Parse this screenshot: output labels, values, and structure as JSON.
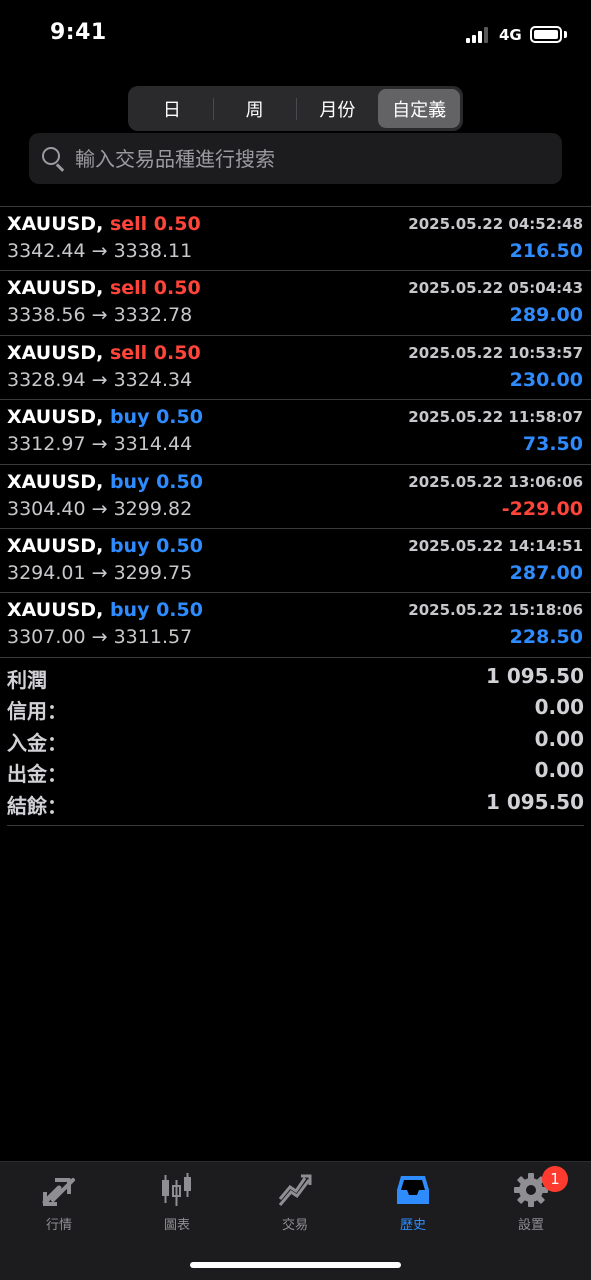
{
  "status_bar": {
    "time": "9:41",
    "network": "4G"
  },
  "period_tabs": [
    {
      "label": "日",
      "active": false
    },
    {
      "label": "周",
      "active": false
    },
    {
      "label": "月份",
      "active": false
    },
    {
      "label": "自定義",
      "active": true
    }
  ],
  "search": {
    "placeholder": "輸入交易品種進行搜索",
    "value": ""
  },
  "trades": [
    {
      "symbol": "XAUUSD,",
      "side": "sell",
      "volume": "0.50",
      "time": "2025.05.22 04:52:48",
      "open_price": "3342.44",
      "close_price": "3338.11",
      "arrow": "→",
      "profit": "216.50"
    },
    {
      "symbol": "XAUUSD,",
      "side": "sell",
      "volume": "0.50",
      "time": "2025.05.22 05:04:43",
      "open_price": "3338.56",
      "close_price": "3332.78",
      "arrow": "→",
      "profit": "289.00"
    },
    {
      "symbol": "XAUUSD,",
      "side": "sell",
      "volume": "0.50",
      "time": "2025.05.22 10:53:57",
      "open_price": "3328.94",
      "close_price": "3324.34",
      "arrow": "→",
      "profit": "230.00"
    },
    {
      "symbol": "XAUUSD,",
      "side": "buy",
      "volume": "0.50",
      "time": "2025.05.22 11:58:07",
      "open_price": "3312.97",
      "close_price": "3314.44",
      "arrow": "→",
      "profit": "73.50"
    },
    {
      "symbol": "XAUUSD,",
      "side": "buy",
      "volume": "0.50",
      "time": "2025.05.22 13:06:06",
      "open_price": "3304.40",
      "close_price": "3299.82",
      "arrow": "→",
      "profit": "-229.00"
    },
    {
      "symbol": "XAUUSD,",
      "side": "buy",
      "volume": "0.50",
      "time": "2025.05.22 14:14:51",
      "open_price": "3294.01",
      "close_price": "3299.75",
      "arrow": "→",
      "profit": "287.00"
    },
    {
      "symbol": "XAUUSD,",
      "side": "buy",
      "volume": "0.50",
      "time": "2025.05.22 15:18:06",
      "open_price": "3307.00",
      "close_price": "3311.57",
      "arrow": "→",
      "profit": "228.50"
    }
  ],
  "summary": [
    {
      "label": "利潤",
      "value": "1 095.50"
    },
    {
      "label": "信用：",
      "value": "0.00"
    },
    {
      "label": "入金：",
      "value": "0.00"
    },
    {
      "label": "出金：",
      "value": "0.00"
    },
    {
      "label": "結餘：",
      "value": "1 095.50"
    }
  ],
  "tab_bar": [
    {
      "label": "行情",
      "icon": "quotes-icon",
      "active": false
    },
    {
      "label": "圖表",
      "icon": "candlestick-chart-icon",
      "active": false
    },
    {
      "label": "交易",
      "icon": "trade-trend-icon",
      "active": false
    },
    {
      "label": "歷史",
      "icon": "history-inbox-icon",
      "active": true
    },
    {
      "label": "設置",
      "icon": "gear-icon",
      "active": false,
      "badge": "1"
    }
  ],
  "colors": {
    "sell": "#ff453a",
    "buy": "#2f8cff",
    "active_tab": "#2f8cff",
    "inactive_tab": "#8e8e93",
    "background": "#000000"
  }
}
